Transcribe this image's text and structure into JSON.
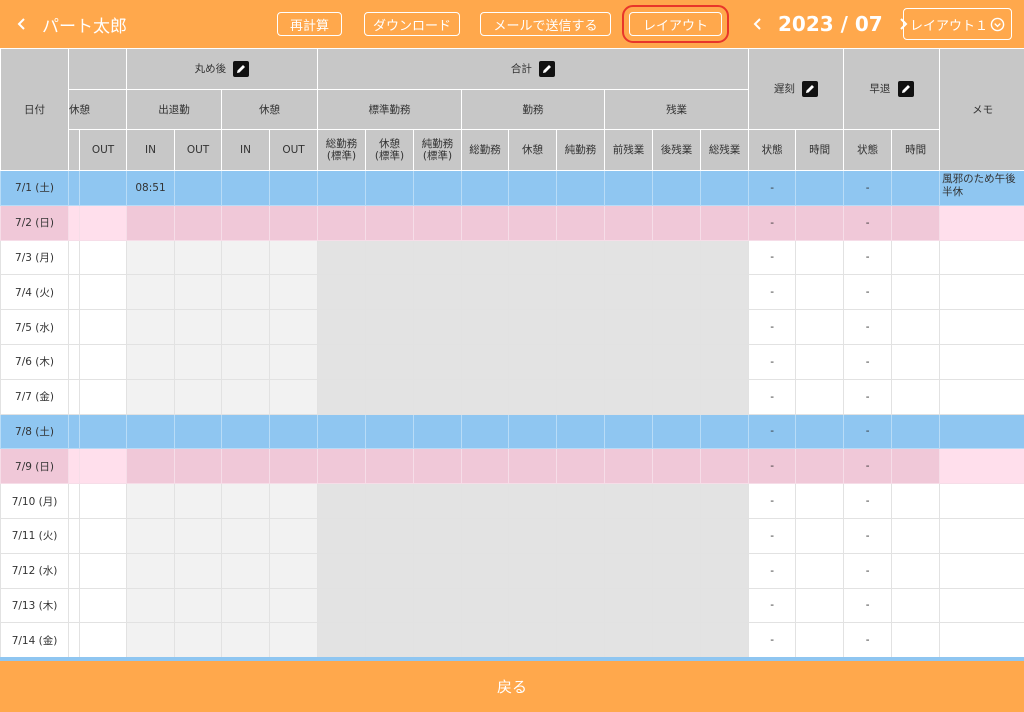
{
  "header": {
    "back_arrow": "‹",
    "person_name": "パート太郎",
    "recalc_label": "再計算",
    "download_label": "ダウンロード",
    "mail_label": "メールで送信する",
    "layout_label": "レイアウト",
    "month": "2023 / 07",
    "prev_icon": "chevron-left-icon",
    "next_icon": "chevron-right-icon",
    "layout_select": "レイアウト１"
  },
  "table": {
    "groups": {
      "date": "日付",
      "rounded": "丸め後",
      "total": "合計",
      "late": "遅刻",
      "early": "早退",
      "memo": "メモ"
    },
    "subgroups": {
      "break_left": "休憩",
      "attendance": "出退勤",
      "break": "休憩",
      "standard": "標準勤務",
      "work": "勤務",
      "overtime": "残業"
    },
    "columns": {
      "out0": "OUT",
      "in1": "IN",
      "out1": "OUT",
      "in2": "IN",
      "out2": "OUT",
      "std_total": "総勤務\n(標準)",
      "std_break": "休憩\n(標準)",
      "std_net": "純勤務\n(標準)",
      "w_total": "総勤務",
      "w_break": "休憩",
      "w_net": "純勤務",
      "ot_pre": "前残業",
      "ot_post": "後残業",
      "ot_total": "総残業",
      "late_state": "状態",
      "late_time": "時間",
      "early_state": "状態",
      "early_time": "時間"
    },
    "rows": [
      {
        "date": "7/1 (土)",
        "type": "sat",
        "in1": "08:51",
        "late_state": "-",
        "early_state": "-",
        "memo": "風邪のため午後半休"
      },
      {
        "date": "7/2 (日)",
        "type": "sun",
        "in1": "",
        "late_state": "-",
        "early_state": "-",
        "memo": ""
      },
      {
        "date": "7/3 (月)",
        "type": "wk",
        "in1": "",
        "late_state": "-",
        "early_state": "-",
        "memo": ""
      },
      {
        "date": "7/4 (火)",
        "type": "wk",
        "in1": "",
        "late_state": "-",
        "early_state": "-",
        "memo": ""
      },
      {
        "date": "7/5 (水)",
        "type": "wk",
        "in1": "",
        "late_state": "-",
        "early_state": "-",
        "memo": ""
      },
      {
        "date": "7/6 (木)",
        "type": "wk",
        "in1": "",
        "late_state": "-",
        "early_state": "-",
        "memo": ""
      },
      {
        "date": "7/7 (金)",
        "type": "wk",
        "in1": "",
        "late_state": "-",
        "early_state": "-",
        "memo": ""
      },
      {
        "date": "7/8 (土)",
        "type": "sat",
        "in1": "",
        "late_state": "-",
        "early_state": "-",
        "memo": ""
      },
      {
        "date": "7/9 (日)",
        "type": "sun",
        "in1": "",
        "late_state": "-",
        "early_state": "-",
        "memo": ""
      },
      {
        "date": "7/10 (月)",
        "type": "wk",
        "in1": "",
        "late_state": "-",
        "early_state": "-",
        "memo": ""
      },
      {
        "date": "7/11 (火)",
        "type": "wk",
        "in1": "",
        "late_state": "-",
        "early_state": "-",
        "memo": ""
      },
      {
        "date": "7/12 (水)",
        "type": "wk",
        "in1": "",
        "late_state": "-",
        "early_state": "-",
        "memo": ""
      },
      {
        "date": "7/13 (木)",
        "type": "wk",
        "in1": "",
        "late_state": "-",
        "early_state": "-",
        "memo": ""
      },
      {
        "date": "7/14 (金)",
        "type": "wk",
        "in1": "",
        "late_state": "-",
        "early_state": "-",
        "memo": ""
      }
    ]
  },
  "footer": {
    "back_label": "戻る"
  },
  "colors": {
    "accent": "#ffa84c",
    "saturday_row": "#8fc6f1",
    "sunday_row": "#f0c8d8",
    "highlight_border": "#e8362a"
  }
}
